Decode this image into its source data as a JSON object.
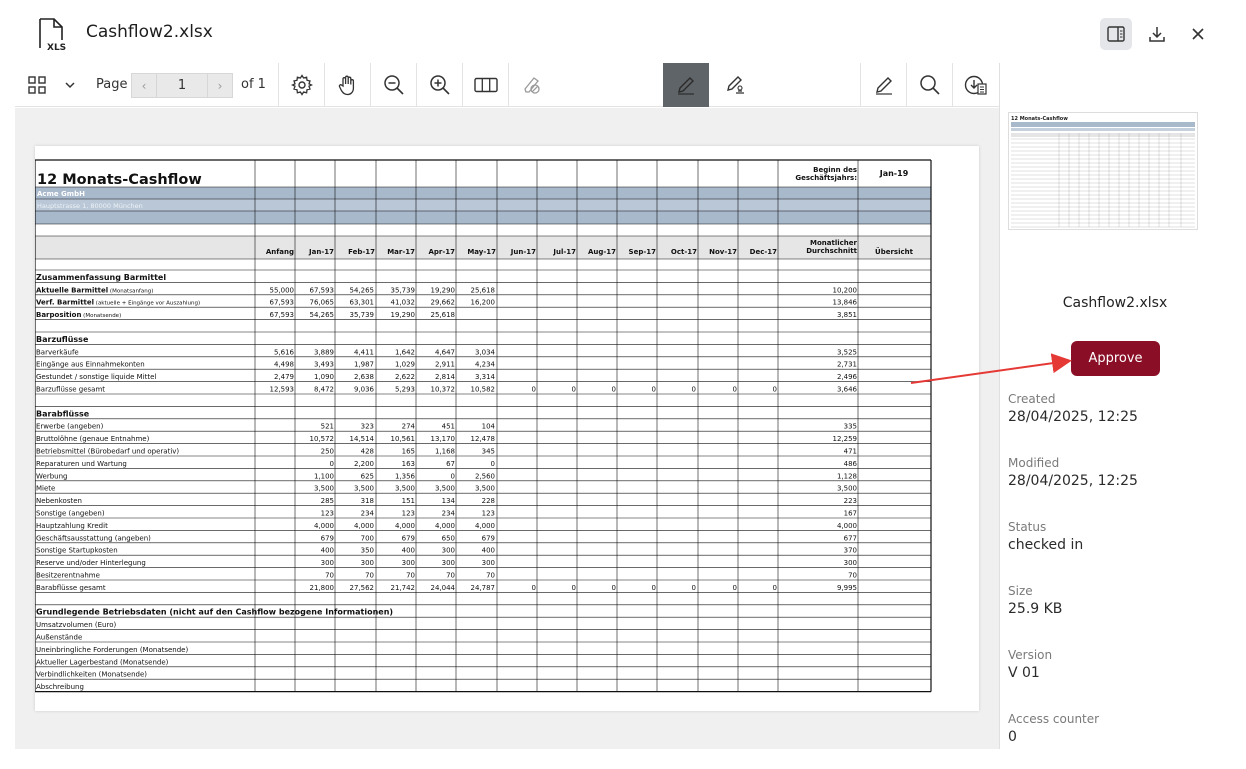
{
  "header": {
    "file_icon_text": "XLS",
    "title": "Cashflow2.xlsx"
  },
  "toolbar": {
    "page_label": "Page",
    "page_value": "1",
    "page_of": "of 1"
  },
  "sheet": {
    "title": "12 Monats-Cashflow",
    "company": "Acme GmbH",
    "address": "Hauptstrasse 1, 80000 München",
    "begin_label_1": "Beginn des",
    "begin_label_2": "Geschäftsjahrs:",
    "begin_value": "Jan-19",
    "columns": [
      "Anfang",
      "Jan-17",
      "Feb-17",
      "Mar-17",
      "Apr-17",
      "May-17",
      "Jun-17",
      "Jul-17",
      "Aug-17",
      "Sep-17",
      "Oct-17",
      "Nov-17",
      "Dec-17"
    ],
    "avg_label_1": "Monatlicher",
    "avg_label_2": "Durchschnitt",
    "overview_label": "Übersicht",
    "rows": [
      {
        "label": "Zusammenfassung Barmittel",
        "section": true,
        "vals": [],
        "avg": ""
      },
      {
        "label": "Aktuelle Barmittel",
        "note": "(Monatsanfang)",
        "bold": true,
        "vals": [
          "55,000",
          "67,593",
          "54,265",
          "35,739",
          "19,290",
          "25,618"
        ],
        "avg": "10,200"
      },
      {
        "label": "Verf. Barmittel",
        "note": "(aktuelle + Eingänge vor Auszahlung)",
        "bold": true,
        "vals": [
          "67,593",
          "76,065",
          "63,301",
          "41,032",
          "29,662",
          "16,200"
        ],
        "avg": "13,846"
      },
      {
        "label": "Barposition",
        "note": "(Monatsende)",
        "bold": true,
        "vals": [
          "67,593",
          "54,265",
          "35,739",
          "19,290",
          "25,618"
        ],
        "avg": "3,851"
      },
      {
        "label": "",
        "vals": [],
        "avg": ""
      },
      {
        "label": "Barzuflüsse",
        "section": true,
        "vals": [],
        "avg": ""
      },
      {
        "label": "Barverkäufe",
        "vals": [
          "5,616",
          "3,889",
          "4,411",
          "1,642",
          "4,647",
          "3,034"
        ],
        "avg": "3,525"
      },
      {
        "label": "Eingänge aus Einnahmekonten",
        "vals": [
          "4,498",
          "3,493",
          "1,987",
          "1,029",
          "2,911",
          "4,234"
        ],
        "avg": "2,731"
      },
      {
        "label": "Gestundet / sonstige liquide Mittel",
        "vals": [
          "2,479",
          "1,090",
          "2,638",
          "2,622",
          "2,814",
          "3,314"
        ],
        "avg": "2,496"
      },
      {
        "label": "Barzuflüsse gesamt",
        "vals": [
          "12,593",
          "8,472",
          "9,036",
          "5,293",
          "10,372",
          "10,582",
          "0",
          "0",
          "0",
          "0",
          "0",
          "0",
          "0"
        ],
        "avg": "3,646"
      },
      {
        "label": "",
        "vals": [],
        "avg": ""
      },
      {
        "label": "Barabflüsse",
        "section": true,
        "vals": [],
        "avg": ""
      },
      {
        "label": "Erwerbe (angeben)",
        "vals": [
          "",
          "521",
          "323",
          "274",
          "451",
          "104"
        ],
        "avg": "335"
      },
      {
        "label": "Bruttolöhne (genaue Entnahme)",
        "vals": [
          "",
          "10,572",
          "14,514",
          "10,561",
          "13,170",
          "12,478"
        ],
        "avg": "12,259"
      },
      {
        "label": "Betriebsmittel (Bürobedarf und operativ)",
        "vals": [
          "",
          "250",
          "428",
          "165",
          "1,168",
          "345"
        ],
        "avg": "471"
      },
      {
        "label": "Reparaturen und Wartung",
        "vals": [
          "",
          "0",
          "2,200",
          "163",
          "67",
          "0"
        ],
        "avg": "486"
      },
      {
        "label": "Werbung",
        "vals": [
          "",
          "1,100",
          "625",
          "1,356",
          "0",
          "2,560"
        ],
        "avg": "1,128"
      },
      {
        "label": "Miete",
        "vals": [
          "",
          "3,500",
          "3,500",
          "3,500",
          "3,500",
          "3,500"
        ],
        "avg": "3,500"
      },
      {
        "label": "Nebenkosten",
        "vals": [
          "",
          "285",
          "318",
          "151",
          "134",
          "228"
        ],
        "avg": "223"
      },
      {
        "label": "Sonstige (angeben)",
        "vals": [
          "",
          "123",
          "234",
          "123",
          "234",
          "123"
        ],
        "avg": "167"
      },
      {
        "label": "Hauptzahlung Kredit",
        "vals": [
          "",
          "4,000",
          "4,000",
          "4,000",
          "4,000",
          "4,000"
        ],
        "avg": "4,000"
      },
      {
        "label": "Geschäftsausstattung (angeben)",
        "vals": [
          "",
          "679",
          "700",
          "679",
          "650",
          "679"
        ],
        "avg": "677"
      },
      {
        "label": "Sonstige Startupkosten",
        "vals": [
          "",
          "400",
          "350",
          "400",
          "300",
          "400"
        ],
        "avg": "370"
      },
      {
        "label": "Reserve und/oder Hinterlegung",
        "vals": [
          "",
          "300",
          "300",
          "300",
          "300",
          "300"
        ],
        "avg": "300"
      },
      {
        "label": "Besitzerentnahme",
        "vals": [
          "",
          "70",
          "70",
          "70",
          "70",
          "70"
        ],
        "avg": "70"
      },
      {
        "label": "Barabflüsse gesamt",
        "vals": [
          "",
          "21,800",
          "27,562",
          "21,742",
          "24,044",
          "24,787",
          "0",
          "0",
          "0",
          "0",
          "0",
          "0",
          "0"
        ],
        "avg": "9,995"
      },
      {
        "label": "",
        "vals": [],
        "avg": ""
      },
      {
        "label": "Grundlegende Betriebsdaten (nicht auf den Cashflow bezogene Informationen)",
        "section": true,
        "span": true,
        "vals": [],
        "avg": ""
      },
      {
        "label": "Umsatzvolumen (Euro)",
        "vals": [],
        "avg": ""
      },
      {
        "label": "Außenstände",
        "vals": [],
        "avg": ""
      },
      {
        "label": "Uneinbringliche Forderungen (Monatsende)",
        "vals": [],
        "avg": ""
      },
      {
        "label": "Aktueller Lagerbestand (Monatsende)",
        "vals": [],
        "avg": ""
      },
      {
        "label": "Verbindlichkeiten (Monatsende)",
        "vals": [],
        "avg": ""
      },
      {
        "label": "Abschreibung",
        "vals": [],
        "avg": ""
      }
    ]
  },
  "sidebar": {
    "file_name": "Cashflow2.xlsx",
    "approve_label": "Approve",
    "created_label": "Created",
    "created_value": "28/04/2025, 12:25",
    "modified_label": "Modified",
    "modified_value": "28/04/2025, 12:25",
    "status_label": "Status",
    "status_value": "checked in",
    "size_label": "Size",
    "size_value": "25.9 KB",
    "version_label": "Version",
    "version_value": "V 01",
    "access_label": "Access counter",
    "access_value": "0"
  },
  "colors": {
    "approve": "#8a0f26",
    "annotation_arrow": "#e53935",
    "company_band": "#a9b9cc"
  },
  "icons": [
    "xls-file-icon",
    "panel-toggle-icon",
    "download-icon",
    "close-icon",
    "grid-view-icon",
    "chevron-down-icon",
    "settings-gear-icon",
    "hand-pan-icon",
    "zoom-out-icon",
    "zoom-in-icon",
    "columns-icon",
    "eraser-icon",
    "pen-icon",
    "pen-edit-icon",
    "signature-pen-icon",
    "search-icon",
    "download-document-icon"
  ]
}
